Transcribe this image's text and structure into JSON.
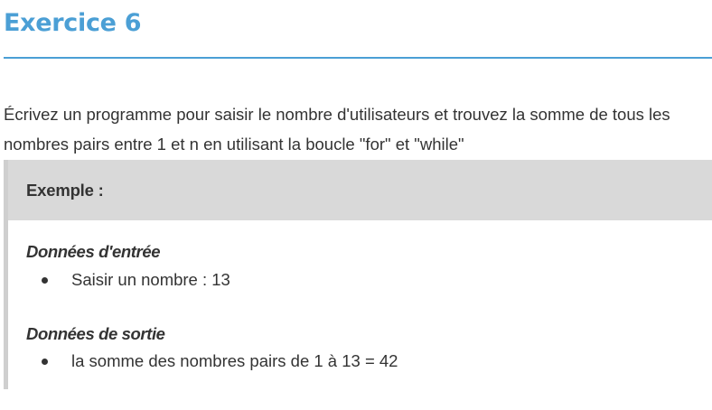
{
  "title": "Exercice 6",
  "description": "Écrivez un programme pour saisir le nombre d'utilisateurs et trouvez la somme de tous les nombres pairs entre 1 et n en utilisant la boucle \"for\" et \"while\"",
  "example": {
    "label": "Exemple :",
    "input_section": {
      "heading": "Données d'entrée",
      "items": [
        "Saisir un nombre : 13"
      ]
    },
    "output_section": {
      "heading": "Données de sortie",
      "items": [
        "la somme des nombres pairs de 1 à 13 = 42"
      ]
    }
  },
  "colors": {
    "accent": "#4b9fd5",
    "text": "#333333",
    "example_header_bg": "#d9d9d9",
    "example_border": "#cfcfcf"
  }
}
